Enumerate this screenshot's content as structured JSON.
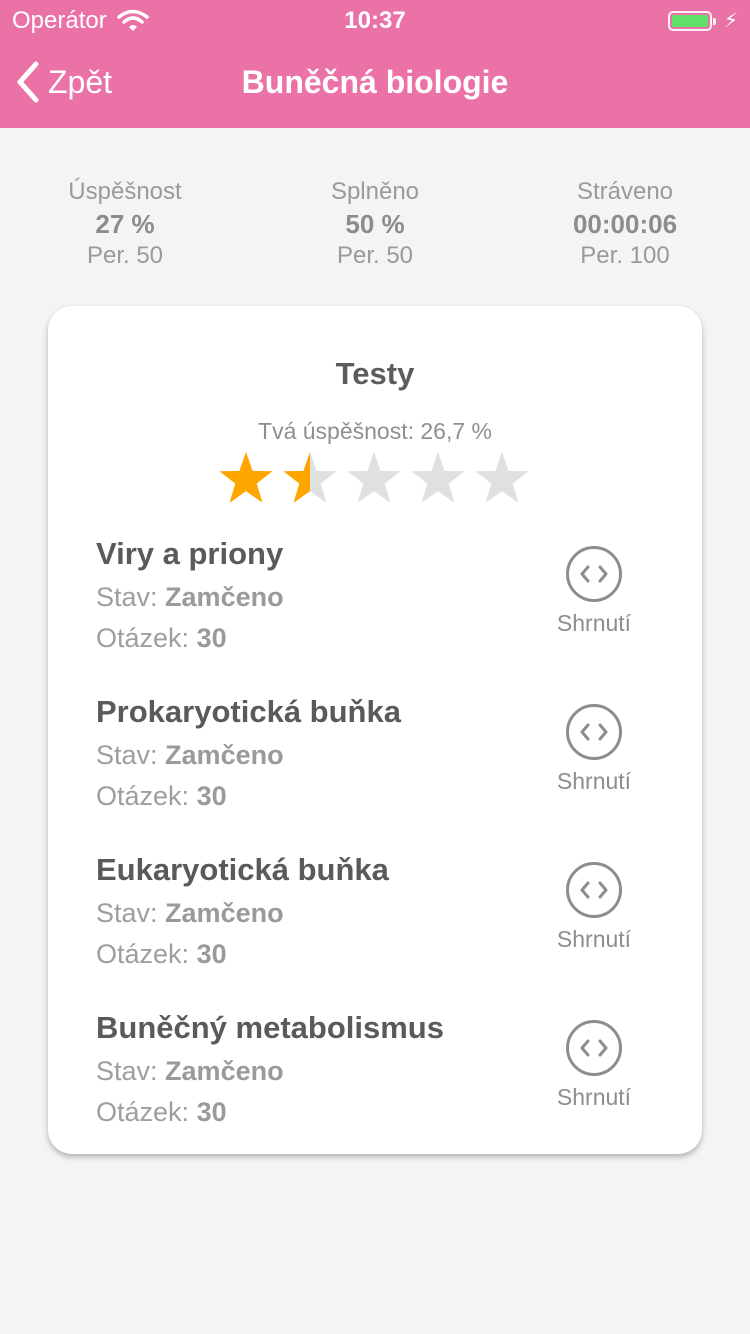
{
  "status_bar": {
    "carrier": "Operátor",
    "time": "10:37"
  },
  "nav": {
    "back_label": "Zpět",
    "title": "Buněčná biologie"
  },
  "stats": [
    {
      "label": "Úspěšnost",
      "value": "27 %",
      "sub": "Per. 50"
    },
    {
      "label": "Splněno",
      "value": "50 %",
      "sub": "Per. 50"
    },
    {
      "label": "Stráveno",
      "value": "00:00:06",
      "sub": "Per. 100"
    }
  ],
  "card": {
    "title": "Testy",
    "success_text": "Tvá úspěšnost: 26,7 %",
    "rating": 1.5,
    "rating_max": 5,
    "state_label": "Stav:",
    "questions_label": "Otázek:",
    "summary_label": "Shrnutí",
    "tests": [
      {
        "name": "Viry a priony",
        "state": "Zamčeno",
        "questions": "30"
      },
      {
        "name": "Prokaryotická buňka",
        "state": "Zamčeno",
        "questions": "30"
      },
      {
        "name": "Eukaryotická buňka",
        "state": "Zamčeno",
        "questions": "30"
      },
      {
        "name": "Buněčný metabolismus",
        "state": "Zamčeno",
        "questions": "30"
      }
    ]
  },
  "colors": {
    "header": "#ea72a6",
    "star_filled": "#ffa500",
    "star_empty": "#e0e0e0"
  },
  "icons": {
    "back": "chevron-left-icon",
    "wifi": "wifi-icon",
    "battery": "battery-icon",
    "summary": "code-brackets-icon",
    "star": "star-icon"
  }
}
